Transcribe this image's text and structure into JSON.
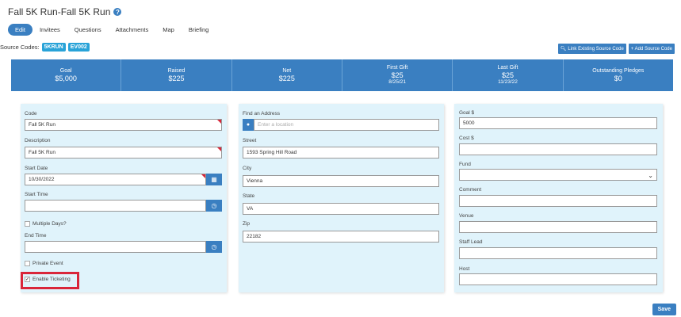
{
  "page": {
    "title": "Fall 5K Run-Fall 5K Run"
  },
  "tabs": [
    {
      "label": "Edit"
    },
    {
      "label": "Invitees"
    },
    {
      "label": "Questions"
    },
    {
      "label": "Attachments"
    },
    {
      "label": "Map"
    },
    {
      "label": "Briefing"
    }
  ],
  "source_codes": {
    "label": "Source Codes:",
    "badges": [
      "5KRUN",
      "EV002"
    ],
    "link_button": "Link Existing Source Code",
    "add_button": "+ Add Source Code"
  },
  "stats": [
    {
      "label": "Goal",
      "value": "$5,000",
      "sub": ""
    },
    {
      "label": "Raised",
      "value": "$225",
      "sub": ""
    },
    {
      "label": "Net",
      "value": "$225",
      "sub": ""
    },
    {
      "label": "First Gift",
      "value": "$25",
      "sub": "8/25/21"
    },
    {
      "label": "Last Gift",
      "value": "$25",
      "sub": "11/23/22"
    },
    {
      "label": "Outstanding Pledges",
      "value": "$0",
      "sub": ""
    }
  ],
  "left": {
    "code_label": "Code",
    "code_value": "Fall 5K Run",
    "description_label": "Description",
    "description_value": "Fall 5K Run",
    "start_date_label": "Start Date",
    "start_date_value": "10/30/2022",
    "start_time_label": "Start Time",
    "start_time_value": "",
    "multiple_days_label": "Multiple Days?",
    "end_time_label": "End Time",
    "end_time_value": "",
    "private_event_label": "Private Event",
    "enable_ticketing_label": "Enable Ticketing"
  },
  "middle": {
    "find_address_label": "Find an Address",
    "find_address_placeholder": "Enter a location",
    "street_label": "Street",
    "street_value": "1593 Spring Hill Road",
    "city_label": "City",
    "city_value": "Vienna",
    "state_label": "State",
    "state_value": "VA",
    "zip_label": "Zip",
    "zip_value": "22182"
  },
  "right": {
    "goal_label": "Goal $",
    "goal_value": "5000",
    "cost_label": "Cost $",
    "cost_value": "",
    "fund_label": "Fund",
    "fund_value": "",
    "comment_label": "Comment",
    "comment_value": "",
    "venue_label": "Venue",
    "venue_value": "",
    "staff_lead_label": "Staff Lead",
    "staff_lead_value": "",
    "host_label": "Host",
    "host_value": ""
  },
  "save_label": "Save",
  "colors": {
    "primary": "#3a7fc1",
    "badge": "#29a3d8",
    "panel": "#e0f3fb",
    "highlight": "#d9263a"
  }
}
